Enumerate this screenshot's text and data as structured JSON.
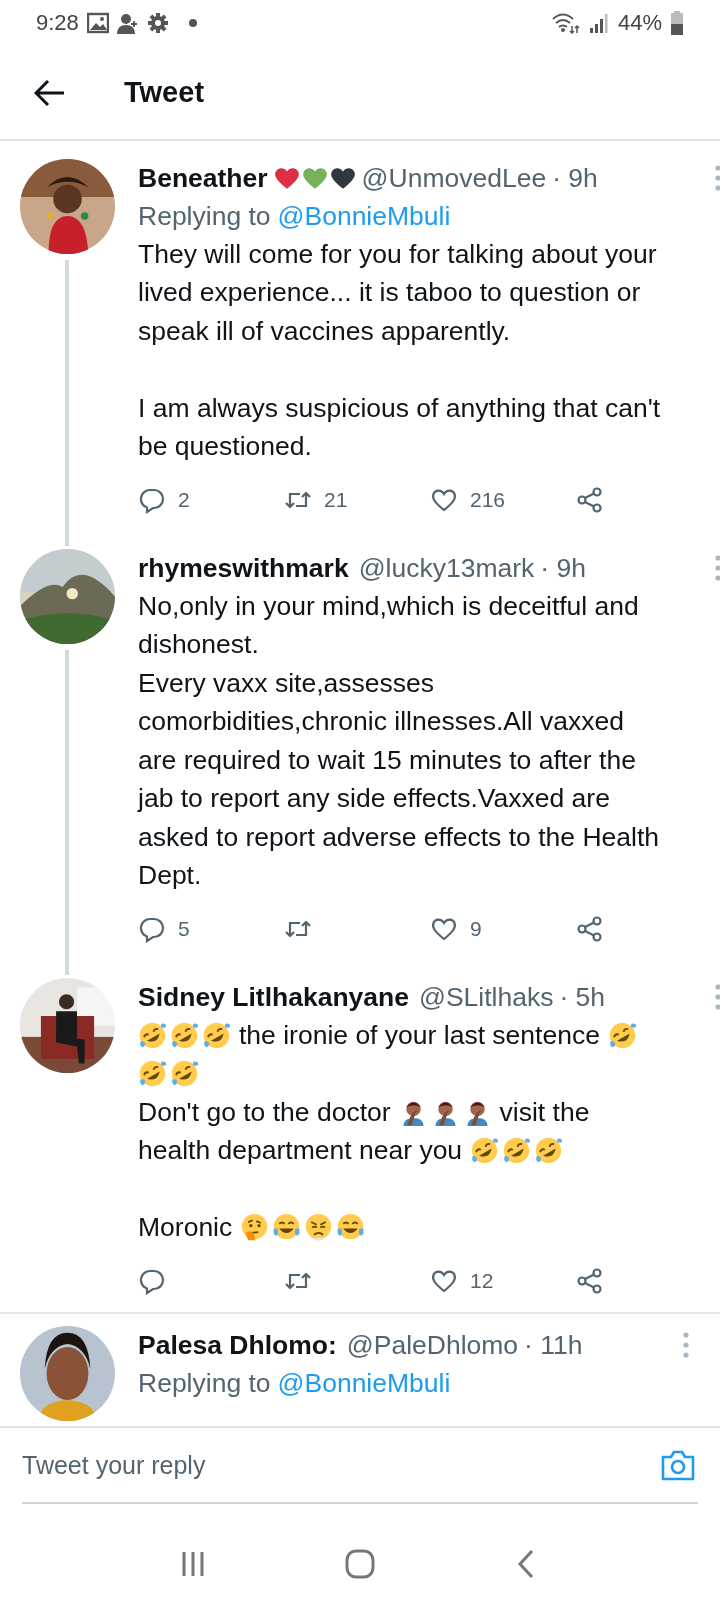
{
  "status_bar": {
    "time": "9:28",
    "battery": "44%"
  },
  "header": {
    "title": "Tweet"
  },
  "tweets": [
    {
      "name": "Beneather",
      "badges": [
        {
          "kind": "heart",
          "color": "#dd2e44"
        },
        {
          "kind": "heart",
          "color": "#78b159"
        },
        {
          "kind": "heart",
          "color": "#31373d"
        }
      ],
      "handle": "@UnmovedLee",
      "time": "· 9h",
      "replying_label": "Replying to",
      "replying_handle": "@BonnieMbuli",
      "thread_line": true,
      "lines": [
        {
          "parts": [
            {
              "kind": "text",
              "text": "They will come for you for talking about your"
            }
          ]
        },
        {
          "parts": [
            {
              "kind": "text",
              "text": "lived experience... it is taboo to question or"
            }
          ]
        },
        {
          "parts": [
            {
              "kind": "text",
              "text": "speak ill of vaccines apparently."
            }
          ]
        },
        {
          "space_before": true,
          "parts": [
            {
              "kind": "text",
              "text": "I am always suspicious of anything that can't"
            }
          ]
        },
        {
          "parts": [
            {
              "kind": "text",
              "text": "be questioned."
            }
          ]
        }
      ],
      "replies": "2",
      "retweets": "21",
      "likes": "216"
    },
    {
      "name": "rhymeswithmark",
      "handle": "@lucky13mark",
      "time": "· 9h",
      "thread_line": true,
      "lines": [
        {
          "parts": [
            {
              "kind": "text",
              "text": "No,only in your mind,which is deceitful and"
            }
          ]
        },
        {
          "parts": [
            {
              "kind": "text",
              "text": "dishonest."
            }
          ]
        },
        {
          "parts": [
            {
              "kind": "text",
              "text": "Every vaxx site,assesses"
            }
          ]
        },
        {
          "parts": [
            {
              "kind": "text",
              "text": "comorbidities,chronic illnesses.All vaxxed"
            }
          ]
        },
        {
          "parts": [
            {
              "kind": "text",
              "text": "are required to wait 15 minutes to after the"
            }
          ]
        },
        {
          "parts": [
            {
              "kind": "text",
              "text": "jab to report any side effects.Vaxxed are"
            }
          ]
        },
        {
          "parts": [
            {
              "kind": "text",
              "text": "asked to report adverse effects to the Health"
            }
          ]
        },
        {
          "parts": [
            {
              "kind": "text",
              "text": "Dept."
            }
          ]
        }
      ],
      "replies": "5",
      "likes": "9"
    },
    {
      "name": "Sidney Litlhakanyane",
      "handle": "@SLitlhaks",
      "time": "· 5h",
      "thread_line": false,
      "lines": [
        {
          "parts": [
            {
              "kind": "rofl"
            },
            {
              "kind": "rofl"
            },
            {
              "kind": "rofl"
            },
            {
              "kind": "text",
              "text": "the ironie of your last sentence"
            },
            {
              "kind": "rofl"
            }
          ]
        },
        {
          "parts": [
            {
              "kind": "rofl"
            },
            {
              "kind": "rofl"
            }
          ]
        },
        {
          "parts": [
            {
              "kind": "text",
              "text": "Don't go to the doctor"
            },
            {
              "kind": "facepalm"
            },
            {
              "kind": "facepalm"
            },
            {
              "kind": "facepalm"
            },
            {
              "kind": "text",
              "text": "visit the"
            }
          ]
        },
        {
          "parts": [
            {
              "kind": "text",
              "text": "health department near you"
            },
            {
              "kind": "rofl"
            },
            {
              "kind": "rofl"
            },
            {
              "kind": "rofl"
            }
          ]
        },
        {
          "space_before": true,
          "parts": [
            {
              "kind": "text",
              "text": "Moronic"
            },
            {
              "kind": "thinking"
            },
            {
              "kind": "joy"
            },
            {
              "kind": "steam"
            },
            {
              "kind": "joy"
            }
          ]
        }
      ],
      "likes": "12"
    },
    {
      "name": "Palesa Dhlomo:",
      "handle": "@PaleDhlomo",
      "time": "· 11h",
      "replying_label": "Replying to",
      "replying_handle": "@BonnieMbuli",
      "thread_line": false
    }
  ],
  "reply_bar": {
    "placeholder": "Tweet your reply"
  }
}
